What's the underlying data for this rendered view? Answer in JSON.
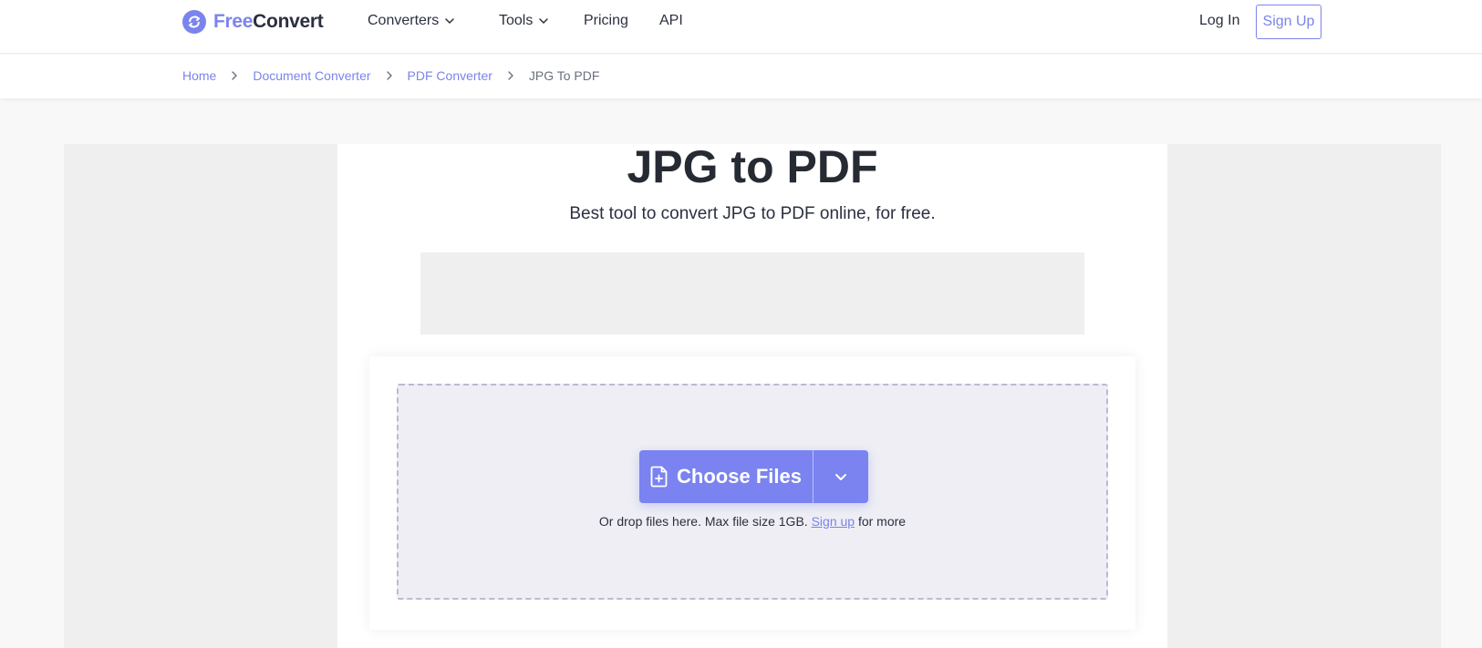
{
  "brand": {
    "name_part1": "Free",
    "name_part2": "Convert",
    "accent": "#7b84ec",
    "logo_icon": "refresh-icon"
  },
  "nav": {
    "converters": "Converters",
    "tools": "Tools",
    "pricing": "Pricing",
    "api": "API",
    "dropdown_icon": "chevron-down-icon"
  },
  "auth": {
    "login": "Log In",
    "signup": "Sign Up"
  },
  "breadcrumb": {
    "home": "Home",
    "document_converter": "Document Converter",
    "pdf_converter": "PDF Converter",
    "current": "JPG To PDF",
    "separator_icon": "chevron-right-icon"
  },
  "main": {
    "title": "JPG to PDF",
    "subtitle": "Best tool to convert JPG to PDF online, for free."
  },
  "upload": {
    "button_label": "Choose Files",
    "button_icon": "file-plus-icon",
    "dropdown_icon": "chevron-down-icon",
    "hint_prefix": "Or drop files here. Max file size 1GB.",
    "hint_link": "Sign up",
    "hint_suffix": "for more",
    "button_color": "#7a83f0"
  }
}
